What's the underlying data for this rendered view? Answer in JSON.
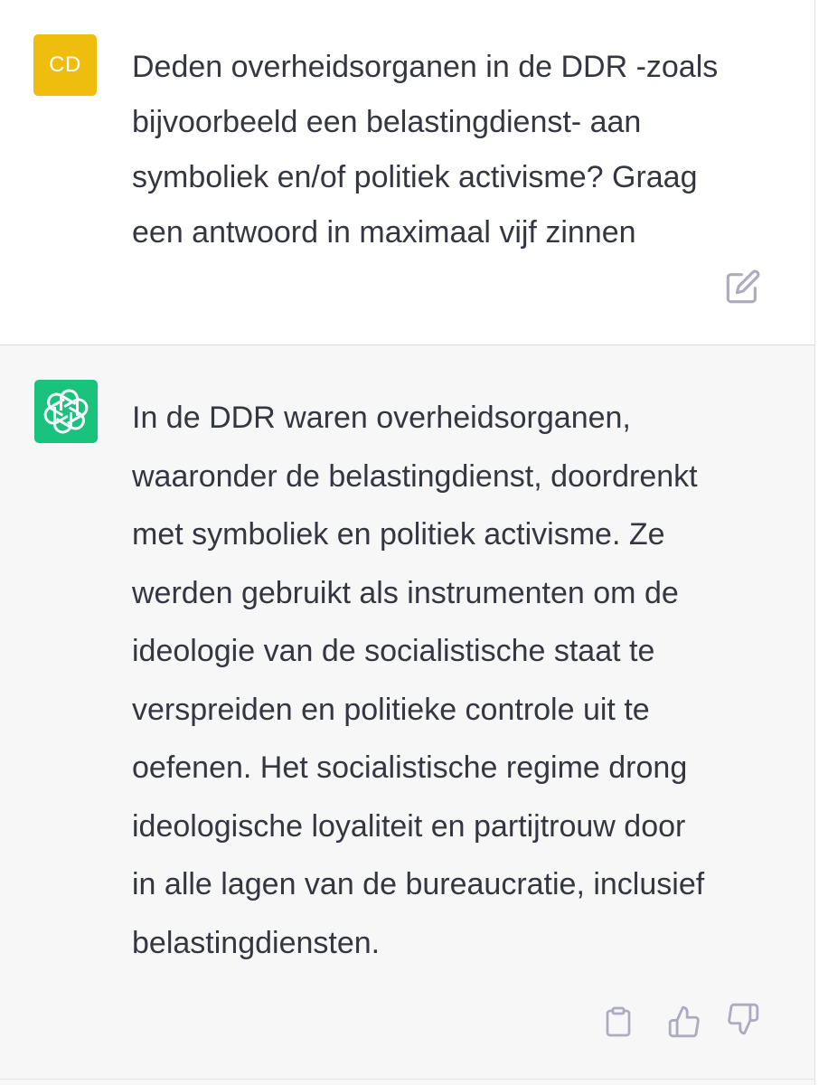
{
  "user_message": {
    "avatar_initials": "CD",
    "avatar_color": "#eebd0e",
    "lines": [
      "Deden overheidsorganen in de DDR -zoals",
      "bijvoorbeeld een belastingdienst- aan",
      "symboliek en/of politiek activisme? Graag",
      "een antwoord in maximaal vijf zinnen"
    ],
    "actions": [
      {
        "icon": "edit-icon"
      }
    ]
  },
  "assistant_message": {
    "avatar_icon": "openai-logo-icon",
    "avatar_color": "#19c37d",
    "lines": [
      "In de DDR waren overheidsorganen,",
      "waaronder de belastingdienst, doordrenkt",
      "met symboliek en politiek activisme. Ze",
      "werden gebruikt als instrumenten om de",
      "ideologie van de socialistische staat te",
      "verspreiden en politieke controle uit te",
      "oefenen. Het socialistische regime drong",
      "ideologische loyaliteit en partijtrouw door",
      "in alle lagen van de bureaucratie, inclusief",
      "belastingdiensten."
    ],
    "actions": [
      {
        "icon": "clipboard-icon"
      },
      {
        "icon": "thumbs-up-icon"
      },
      {
        "icon": "thumbs-down-icon"
      }
    ]
  }
}
